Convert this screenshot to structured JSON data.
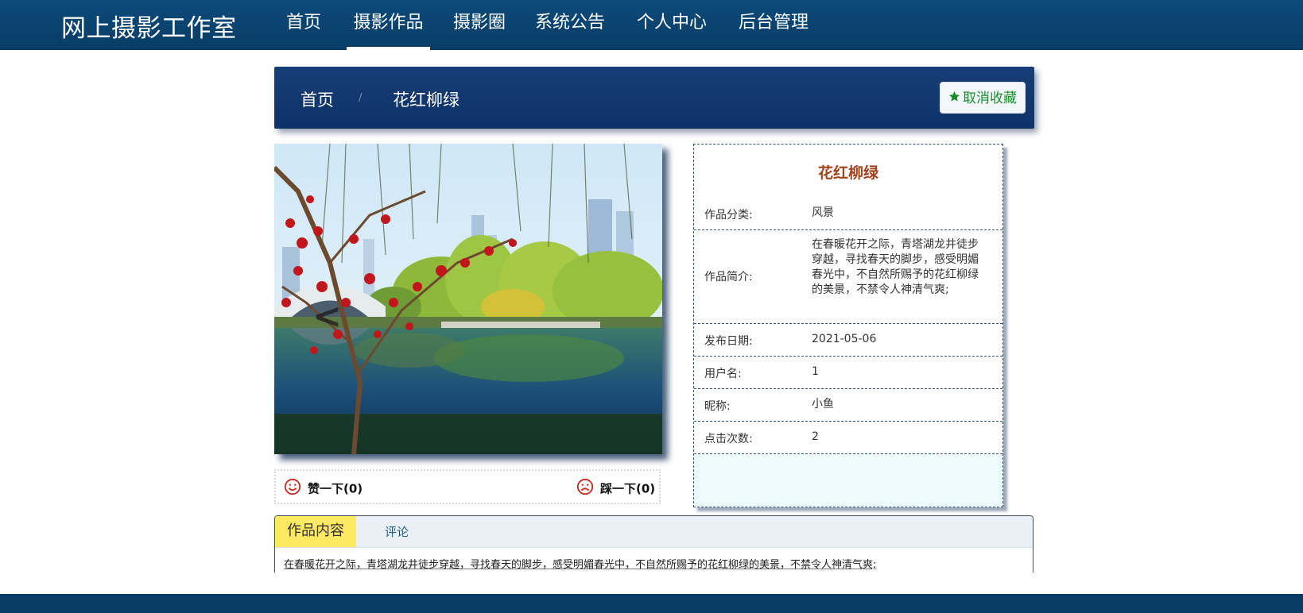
{
  "site": {
    "brand": "网上摄影工作室"
  },
  "nav": {
    "items": [
      {
        "label": "首页"
      },
      {
        "label": "摄影作品",
        "active": true
      },
      {
        "label": "摄影圈"
      },
      {
        "label": "系统公告"
      },
      {
        "label": "个人中心"
      },
      {
        "label": "后台管理"
      }
    ]
  },
  "breadcrumb": {
    "home": "首页",
    "separator": "/",
    "current": "花红柳绿"
  },
  "favorite_button": {
    "label": "取消收藏",
    "icon": "star-icon",
    "color": "#1a8c2e"
  },
  "photo": {
    "alt": "花红柳绿"
  },
  "votes": {
    "like": {
      "label": "赞一下(0)",
      "icon": "smile-icon"
    },
    "dislike": {
      "label": "踩一下(0)",
      "icon": "frown-icon"
    }
  },
  "details": {
    "title": "花红柳绿",
    "rows": [
      {
        "label": "作品分类:",
        "value": "风景"
      },
      {
        "label": "作品简介:",
        "value": "在春暖花开之际，青塔湖龙井徒步穿越，寻找春天的脚步，感受明媚春光中，不自然所赐予的花红柳绿的美景，不禁令人神清气爽;"
      },
      {
        "label": "发布日期:",
        "value": "2021-05-06"
      },
      {
        "label": "用户名:",
        "value": "1"
      },
      {
        "label": "昵称:",
        "value": "小鱼"
      },
      {
        "label": "点击次数:",
        "value": "2"
      }
    ]
  },
  "tabs": {
    "items": [
      {
        "label": "作品内容",
        "active": true
      },
      {
        "label": "评论"
      }
    ],
    "content": "在春暖花开之际，青塔湖龙井徒步穿越，寻找春天的脚步，感受明媚春光中，不自然所赐予的花红柳绿的美景，不禁令人神清气爽;"
  },
  "colors": {
    "nav_bg": "#083d66",
    "crumb_bg": "#0e3268",
    "detail_title": "#a2431b",
    "tab_active_bg": "#fde962",
    "vote_icon": "#c8281e"
  }
}
